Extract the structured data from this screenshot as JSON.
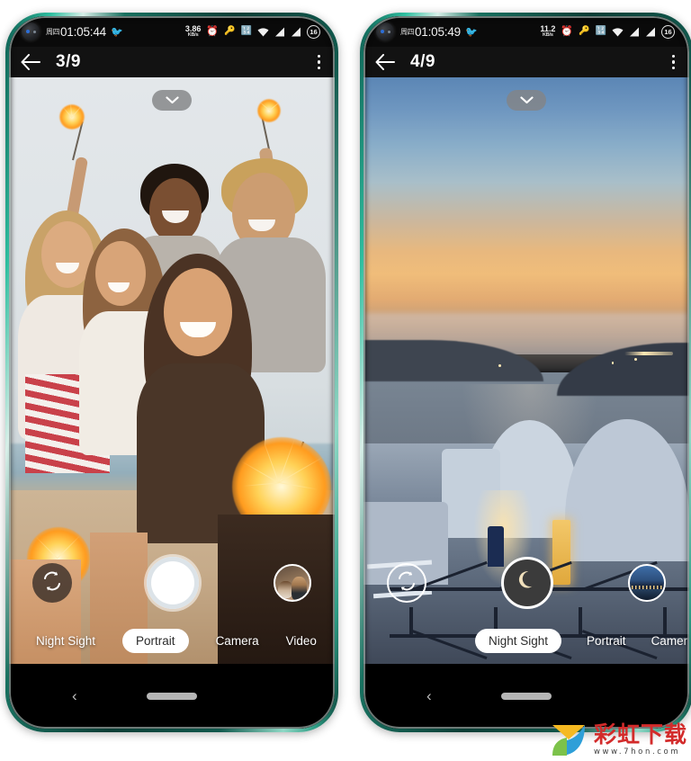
{
  "page": {
    "background_color": "#ffffff"
  },
  "watermark": {
    "brand_cn": "彩虹下载",
    "url": "www.7hon.com",
    "logo_colors": [
      "#f5b921",
      "#2e9fd8",
      "#7cc24a"
    ]
  },
  "phones": [
    {
      "id": "phone-left",
      "frame_color": "#1d7a66",
      "status_bar": {
        "day": "周四",
        "time": "01:05:44",
        "net_speed_value": "3.86",
        "net_speed_unit": "KB/s",
        "icons": [
          "alarm-icon",
          "key-icon",
          "vpn-icon",
          "wifi-icon",
          "signal-icon",
          "signal-icon"
        ],
        "battery": "16"
      },
      "app_bar": {
        "back_label": "←",
        "counter": "3/9",
        "menu": "overflow-menu"
      },
      "photo": {
        "description": "group-selfie-sparklers",
        "scene": "five friends smiling with sparklers on a beach under overcast sky"
      },
      "chevron_pill": "chevron-down",
      "controls": {
        "flip_label": "flip-camera",
        "shutter_label": "shutter",
        "shutter_style": "white",
        "thumbnail_label": "last-photo-woman-with-dog"
      },
      "modes": [
        {
          "label": "Night Sight",
          "active": false
        },
        {
          "label": "Portrait",
          "active": true
        },
        {
          "label": "Camera",
          "active": false
        },
        {
          "label": "Video",
          "active": false
        }
      ],
      "nav_bar": {
        "back": "‹",
        "home": "home-pill"
      }
    },
    {
      "id": "phone-right",
      "frame_color": "#1d7a66",
      "status_bar": {
        "day": "周四",
        "time": "01:05:49",
        "net_speed_value": "11.2",
        "net_speed_unit": "KB/s",
        "icons": [
          "alarm-icon",
          "key-icon",
          "vpn-icon",
          "wifi-icon",
          "signal-icon",
          "signal-icon"
        ],
        "battery": "16"
      },
      "app_bar": {
        "back_label": "←",
        "counter": "4/9",
        "menu": "overflow-menu"
      },
      "photo": {
        "description": "santorini-twilight-seascape",
        "scene": "sunset sea view with white buildings, lit window and dark railing"
      },
      "chevron_pill": "chevron-down",
      "controls": {
        "flip_label": "flip-camera",
        "shutter_label": "shutter",
        "shutter_style": "night-moon",
        "thumbnail_label": "last-photo-night-cityscape"
      },
      "modes": [
        {
          "label": "Night Sight",
          "active": true
        },
        {
          "label": "Portrait",
          "active": false
        },
        {
          "label": "Camer",
          "active": false
        }
      ],
      "nav_bar": {
        "back": "‹",
        "home": "home-pill"
      }
    }
  ]
}
